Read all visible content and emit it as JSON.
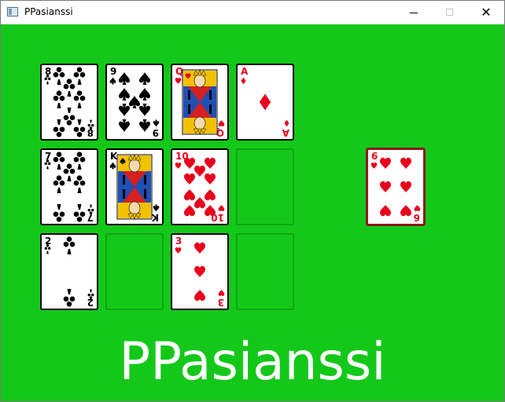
{
  "window": {
    "title": "PPasianssi",
    "controls": {
      "minimize": "minimize",
      "maximize": "maximize",
      "close": "close"
    }
  },
  "colors": {
    "felt": "#14c81a",
    "slot_border": "#0fa413",
    "red": "#e8001c",
    "black": "#000000",
    "selected_border": "#8b1a1a"
  },
  "board": {
    "cards": [
      {
        "rank": "8",
        "suit": "clubs",
        "color": "black"
      },
      {
        "rank": "9",
        "suit": "spades",
        "color": "black"
      },
      {
        "rank": "Q",
        "suit": "hearts",
        "color": "red",
        "face": true
      },
      {
        "rank": "A",
        "suit": "diamonds",
        "color": "red"
      },
      {
        "rank": "7",
        "suit": "clubs",
        "color": "black"
      },
      {
        "rank": "K",
        "suit": "spades",
        "color": "black",
        "face": true
      },
      {
        "rank": "10",
        "suit": "hearts",
        "color": "red"
      },
      {
        "empty": true
      },
      {
        "rank": "2",
        "suit": "clubs",
        "color": "black"
      },
      {
        "empty": true
      },
      {
        "rank": "3",
        "suit": "hearts",
        "color": "red"
      },
      {
        "empty": true
      }
    ],
    "current_card": {
      "rank": "6",
      "suit": "hearts",
      "color": "red",
      "selected": true
    }
  },
  "brand_text": "PPasianssi"
}
